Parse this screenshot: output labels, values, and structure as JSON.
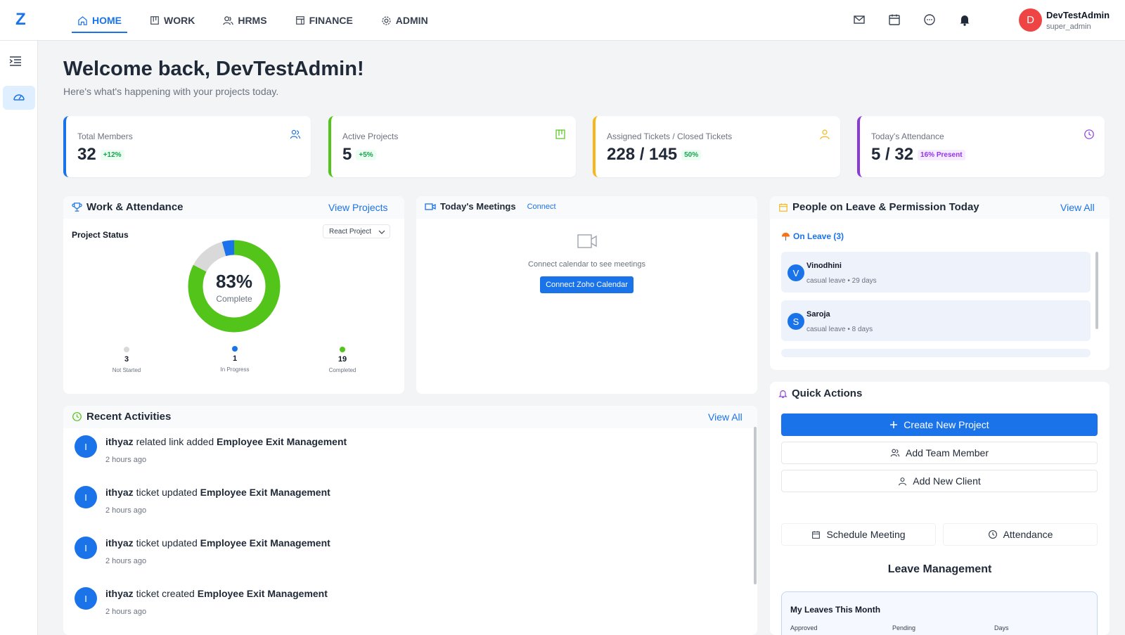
{
  "topbar": {
    "logo": "Z",
    "nav": [
      {
        "label": "HOME",
        "icon": "home-icon",
        "active": true
      },
      {
        "label": "WORK",
        "icon": "board-icon",
        "active": false
      },
      {
        "label": "HRMS",
        "icon": "people-icon",
        "active": false
      },
      {
        "label": "FINANCE",
        "icon": "ledger-icon",
        "active": false
      },
      {
        "label": "ADMIN",
        "icon": "gear-icon",
        "active": false
      }
    ],
    "user": {
      "initial": "D",
      "name": "DevTestAdmin",
      "role": "super_admin"
    }
  },
  "header": {
    "welcome": "Welcome back, DevTestAdmin!",
    "subtitle": "Here's what's happening with your projects today."
  },
  "stats": [
    {
      "label": "Total Members",
      "value": "32",
      "badge": "+12%",
      "color": "#1a73e8",
      "icon": "team-icon"
    },
    {
      "label": "Active Projects",
      "value": "5",
      "badge": "+5%",
      "color": "#52c41a",
      "icon": "project-board-icon"
    },
    {
      "label": "Assigned Tickets / Closed Tickets",
      "value": "228 / 145",
      "badge": "50%",
      "color": "#f5b71a",
      "icon": "user-icon"
    },
    {
      "label": "Today's Attendance",
      "value": "5 / 32",
      "badge": "16% Present",
      "color": "#8b3ad6",
      "icon": "clock-icon"
    }
  ],
  "work_attendance": {
    "title": "Work & Attendance",
    "link": "View Projects",
    "project_status_label": "Project Status",
    "select_value": "React Project",
    "percent": "83%",
    "complete_label": "Complete",
    "legend": [
      {
        "count": "3",
        "label": "Not Started",
        "color": "#d9d9d9"
      },
      {
        "count": "1",
        "label": "In Progress",
        "color": "#1a73e8"
      },
      {
        "count": "19",
        "label": "Completed",
        "color": "#52c41a"
      }
    ]
  },
  "chart_data": {
    "type": "pie",
    "categories": [
      "Not Started",
      "In Progress",
      "Completed"
    ],
    "values": [
      3,
      1,
      19
    ],
    "center_label": "83%"
  },
  "meetings": {
    "title": "Today's Meetings",
    "link": "Connect",
    "empty_text": "Connect calendar to see meetings",
    "button": "Connect Zoho Calendar"
  },
  "leave": {
    "title": "People on Leave & Permission Today",
    "link": "View All",
    "on_leave_label": "On Leave (3)",
    "people": [
      {
        "initial": "V",
        "name": "Vinodhini",
        "meta": "casual leave • 29 days"
      },
      {
        "initial": "S",
        "name": "Saroja",
        "meta": "casual leave • 8 days"
      }
    ]
  },
  "activities": {
    "title": "Recent Activities",
    "link": "View All",
    "items": [
      {
        "initial": "I",
        "user": "ithyaz",
        "action": "related link added",
        "target": "Employee Exit Management",
        "time": "2 hours ago"
      },
      {
        "initial": "I",
        "user": "ithyaz",
        "action": "ticket updated",
        "target": "Employee Exit Management",
        "time": "2 hours ago"
      },
      {
        "initial": "I",
        "user": "ithyaz",
        "action": "ticket updated",
        "target": "Employee Exit Management",
        "time": "2 hours ago"
      },
      {
        "initial": "I",
        "user": "ithyaz",
        "action": "ticket created",
        "target": "Employee Exit Management",
        "time": "2 hours ago"
      }
    ]
  },
  "quick_actions": {
    "title": "Quick Actions",
    "create_project": "Create New Project",
    "add_member": "Add Team Member",
    "add_client": "Add New Client",
    "schedule_meeting": "Schedule Meeting",
    "attendance": "Attendance",
    "leave_management": "Leave Management",
    "my_leaves": "My Leaves This Month",
    "columns": [
      "Approved",
      "Pending",
      "Days"
    ]
  }
}
